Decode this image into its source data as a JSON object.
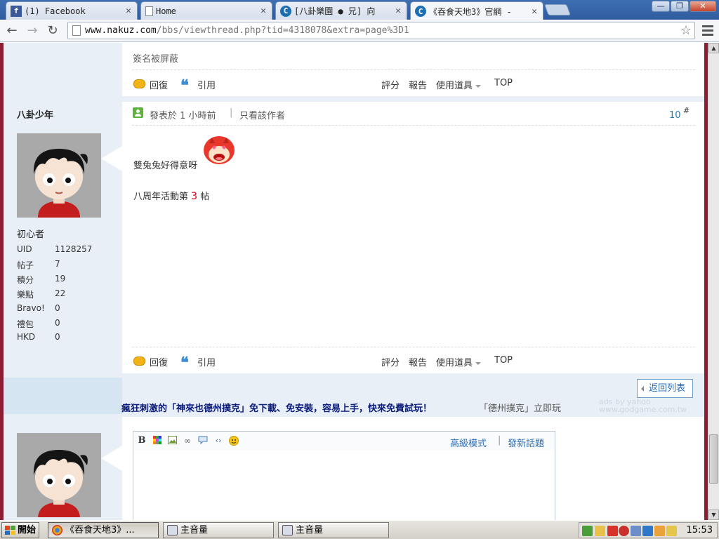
{
  "browser": {
    "tabs": [
      {
        "title": "(1) Facebook",
        "icon": "facebook-icon",
        "active": false
      },
      {
        "title": "Home",
        "icon": "page-icon",
        "active": false
      },
      {
        "title": "[八卦樂園 ● 兄] 向",
        "icon": "nakuz-icon",
        "active": false
      },
      {
        "title": "《吞食天地3》官網 -",
        "icon": "nakuz-icon",
        "active": true
      }
    ],
    "url_host": "www.nakuz.com",
    "url_path": "/bbs/viewthread.php?tid=4318078&extra=page%3D1",
    "window_buttons": {
      "minimize": "—",
      "maximize": "❐",
      "close": "✕"
    }
  },
  "prev_post": {
    "signature_blocked": "簽名被屏蔽",
    "actions": {
      "reply": "回復",
      "quote": "引用",
      "rate": "評分",
      "report": "報告",
      "tools": "使用道具",
      "top": "TOP"
    }
  },
  "post": {
    "author": "八卦少年",
    "rank": "初心者",
    "stats": [
      {
        "label": "UID",
        "value": "1128257"
      },
      {
        "label": "帖子",
        "value": "7"
      },
      {
        "label": "積分",
        "value": "19"
      },
      {
        "label": "樂點",
        "value": "22"
      },
      {
        "label": "Bravo!",
        "value": "0"
      },
      {
        "label": "禮包",
        "value": "0"
      },
      {
        "label": "HKD",
        "value": "0"
      }
    ],
    "posted_at": "發表於 1 小時前",
    "only_author": "只看該作者",
    "floor": "10",
    "floor_suffix": "#",
    "message_line1": "雙兔兔好得意呀",
    "message_line2_prefix": "八周年活動第",
    "message_line2_number": "3",
    "message_line2_suffix": "帖",
    "actions": {
      "reply": "回復",
      "quote": "引用",
      "rate": "評分",
      "report": "報告",
      "tools": "使用道具",
      "top": "TOP"
    }
  },
  "back_to_list": "返回列表",
  "ad": {
    "headline": "瘋狂刺激的「神來也德州撲克」免下載、免安裝，容易上手，快來免費試玩！",
    "tagline": "「德州撲克」立即玩",
    "ads_by": "ads by yahoo",
    "ad_domain": "www.godgame.com.tw"
  },
  "reply_box": {
    "advanced_mode": "高級模式",
    "separator": "|",
    "new_topic": "發新話題",
    "toolbar_icons": [
      "bold-icon",
      "color-icon",
      "image-icon",
      "link-icon",
      "quote-bubble-icon",
      "code-icon",
      "smiley-icon"
    ]
  },
  "taskbar": {
    "start": "開始",
    "tasks": [
      {
        "label": "《吞食天地3》...",
        "icon": "chrome-icon",
        "active": true
      },
      {
        "label": "主音量",
        "icon": "volume-app-icon",
        "active": false
      },
      {
        "label": "主音量",
        "icon": "volume-app-icon",
        "active": false
      }
    ],
    "clock": "15:53"
  },
  "colors": {
    "frame_border": "#8b1d35",
    "sidebar_bg": "#e8eff7",
    "link_blue": "#2a6db5",
    "floor_blue": "#1e7fb8",
    "highlight_red": "#d0021b",
    "ad_headline": "#0a1b7a"
  }
}
